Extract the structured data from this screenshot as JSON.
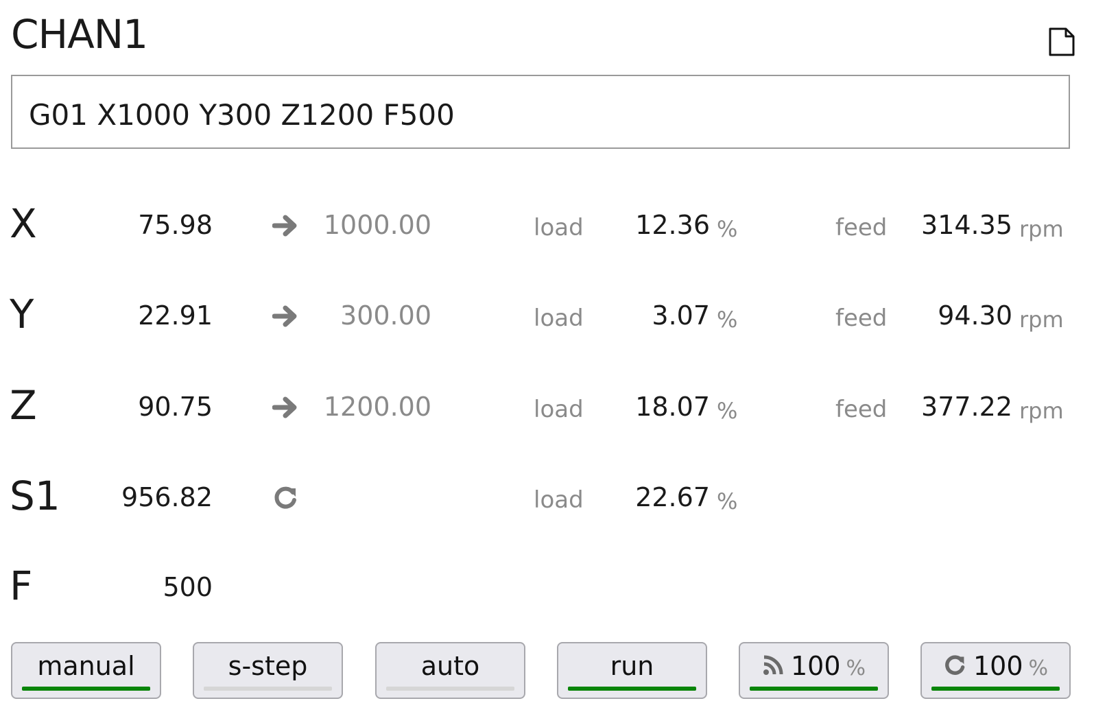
{
  "header": {
    "title": "CHAN1",
    "file_icon": "file-icon"
  },
  "command": {
    "text": "G01 X1000 Y300 Z1200 F500"
  },
  "axes": [
    {
      "name": "X",
      "position": "75.98",
      "icon": "arrow-right-icon",
      "target": "1000.00",
      "load_label": "load",
      "load": "12.36",
      "load_unit": "%",
      "feed_label": "feed",
      "feed": "314.35",
      "feed_unit": "rpm"
    },
    {
      "name": "Y",
      "position": "22.91",
      "icon": "arrow-right-icon",
      "target": "300.00",
      "load_label": "load",
      "load": "3.07",
      "load_unit": "%",
      "feed_label": "feed",
      "feed": "94.30",
      "feed_unit": "rpm"
    },
    {
      "name": "Z",
      "position": "90.75",
      "icon": "arrow-right-icon",
      "target": "1200.00",
      "load_label": "load",
      "load": "18.07",
      "load_unit": "%",
      "feed_label": "feed",
      "feed": "377.22",
      "feed_unit": "rpm"
    }
  ],
  "spindle": {
    "name": "S1",
    "speed": "956.82",
    "icon": "rotate-cw-icon",
    "load_label": "load",
    "load": "22.67",
    "load_unit": "%"
  },
  "feed_row": {
    "name": "F",
    "value": "500"
  },
  "buttons": [
    {
      "label": "manual",
      "active": true
    },
    {
      "label": "s-step",
      "active": false
    },
    {
      "label": "auto",
      "active": false
    },
    {
      "label": "run",
      "active": true
    },
    {
      "label": "100",
      "unit": "%",
      "icon": "feed-override-icon",
      "active": true
    },
    {
      "label": "100",
      "unit": "%",
      "icon": "spindle-override-icon",
      "active": true
    }
  ],
  "colors": {
    "active_bar": "#0a850a",
    "inactive_bar": "#d6d6d6",
    "muted_text": "#8a8a8a",
    "button_bg": "#e9e9ee"
  }
}
